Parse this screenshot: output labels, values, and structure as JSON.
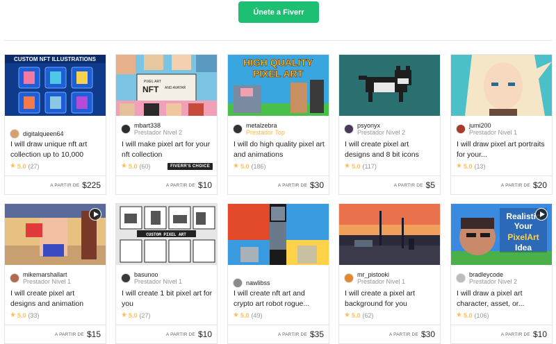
{
  "header": {
    "join_label": "Únete a Fiverr"
  },
  "gigs": [
    {
      "seller": "digitalqueen64",
      "level": "",
      "level_top": false,
      "title": "I will draw unique nft art collection up to 10,000",
      "score": "5.0",
      "count": "(27)",
      "from": "A PARTIR DE",
      "price": "$225",
      "badge": "",
      "video": false,
      "avatar": "#d9a06f",
      "thumb_text": "CUSTOM NFT ILLUSTRATIONS"
    },
    {
      "seller": "mbart338",
      "level": "Prestador Nivel 2",
      "level_top": false,
      "title": "I will make pixel art for your nft collection",
      "score": "5.0",
      "count": "(60)",
      "from": "A PARTIR DE",
      "price": "$10",
      "badge": "FIVERR'S CHOICE",
      "video": false,
      "avatar": "#2e2e2e",
      "thumb_text": "PIXEL ART NFT COLLECTION",
      "thumb_text2": "AND AVATAR"
    },
    {
      "seller": "metalzebra",
      "level": "Prestador Top",
      "level_top": true,
      "title": "I will do high quality pixel art and animations",
      "score": "5.0",
      "count": "(186)",
      "from": "A PARTIR DE",
      "price": "$30",
      "badge": "",
      "video": false,
      "avatar": "#333333",
      "thumb_text": "HIGH QUALITY",
      "thumb_text2": "PIXEL ART"
    },
    {
      "seller": "psyonyx",
      "level": "Prestador Nivel 2",
      "level_top": false,
      "title": "I will create pixel art designs and 8 bit icons",
      "score": "5.0",
      "count": "(117)",
      "from": "A PARTIR DE",
      "price": "$5",
      "badge": "",
      "video": false,
      "avatar": "#4a3a5a"
    },
    {
      "seller": "jumi200",
      "level": "Prestador Nivel 1",
      "level_top": false,
      "title": "I will draw pixel art portraits for your...",
      "score": "5.0",
      "count": "(13)",
      "from": "A PARTIR DE",
      "price": "$20",
      "badge": "",
      "video": false,
      "avatar": "#a83a2a"
    },
    {
      "seller": "mikemarshallart",
      "level": "Prestador Nivel 1",
      "level_top": false,
      "title": "I will create pixel art designs and animation",
      "score": "5.0",
      "count": "(33)",
      "from": "A PARTIR DE",
      "price": "$15",
      "badge": "",
      "video": true,
      "avatar": "#b06a50"
    },
    {
      "seller": "basunoo",
      "level": "Prestador Nivel 1",
      "level_top": false,
      "title": "I will create 1 bit pixel art for you",
      "score": "5.0",
      "count": "(27)",
      "from": "A PARTIR DE",
      "price": "$10",
      "badge": "",
      "video": false,
      "avatar": "#3a3a3a",
      "thumb_text": "CUSTOM PIXEL ART"
    },
    {
      "seller": "nawlibss",
      "level": "",
      "level_top": false,
      "title": "I will create nft art and crypto art robot rogue...",
      "score": "5.0",
      "count": "(49)",
      "from": "A PARTIR DE",
      "price": "$35",
      "badge": "",
      "video": false,
      "avatar": "#8a8a8a"
    },
    {
      "seller": "mr_pistooki",
      "level": "Prestador Nivel 1",
      "level_top": false,
      "title": "I will create a pixel art background for you",
      "score": "5.0",
      "count": "(62)",
      "from": "A PARTIR DE",
      "price": "$30",
      "badge": "",
      "video": false,
      "avatar": "#e08a30"
    },
    {
      "seller": "bradleycode",
      "level": "Prestador Nivel 2",
      "level_top": false,
      "title": "I will draw a pixel art character, asset, or...",
      "score": "5.0",
      "count": "(106)",
      "from": "A PARTIR DE",
      "price": "$10",
      "badge": "",
      "video": true,
      "avatar": "#bbbbbb",
      "thumb_text": "Realistic",
      "thumb_text2": "Your",
      "thumb_text3": "PixelArt",
      "thumb_text4": "Idea"
    }
  ]
}
